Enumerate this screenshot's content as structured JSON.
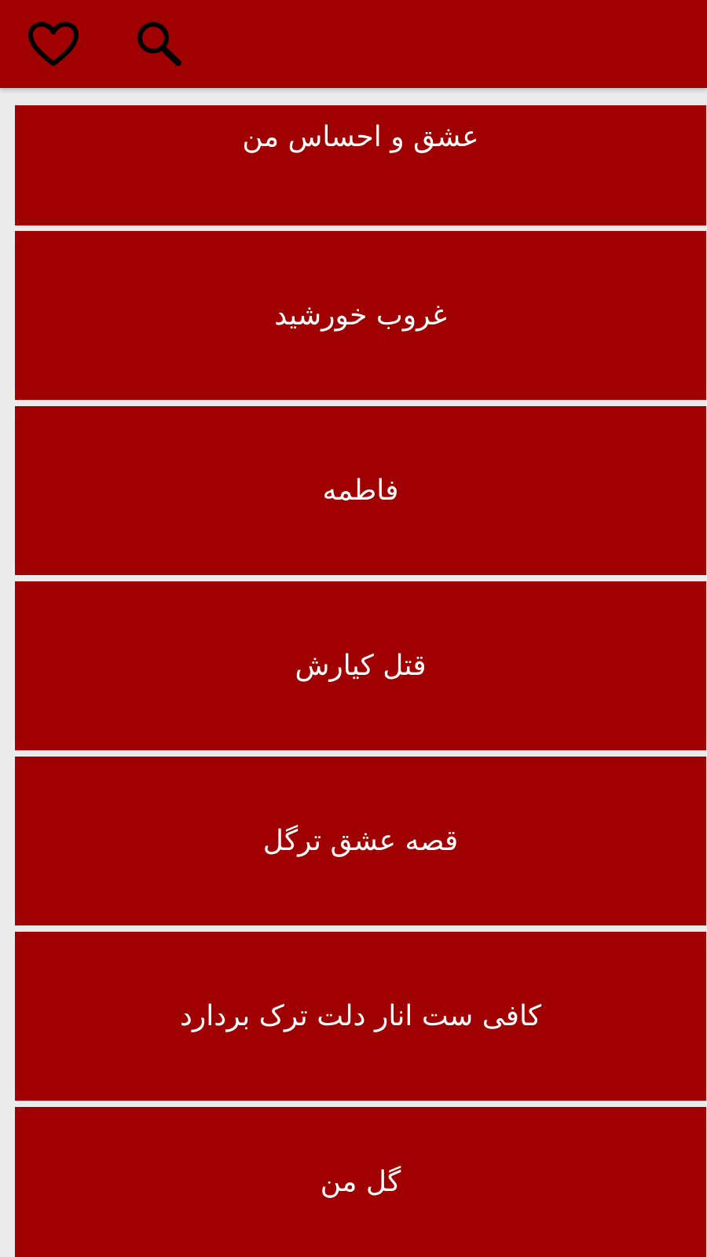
{
  "app_bar": {
    "background_color": "#a00000",
    "icons": [
      {
        "name": "favorites",
        "icon": "heart-outline-icon"
      },
      {
        "name": "search",
        "icon": "search-icon"
      }
    ]
  },
  "list": {
    "background_color": "#a00000",
    "text_color": "#ffffff",
    "items": [
      {
        "label": "عشق و احساس من"
      },
      {
        "label": "غروب خورشید"
      },
      {
        "label": "فاطمه"
      },
      {
        "label": "قتل کیارش"
      },
      {
        "label": "قصه عشق ترگل"
      },
      {
        "label": "کافی ست انار دلت ترک بردارد"
      },
      {
        "label": "گل من"
      }
    ]
  }
}
